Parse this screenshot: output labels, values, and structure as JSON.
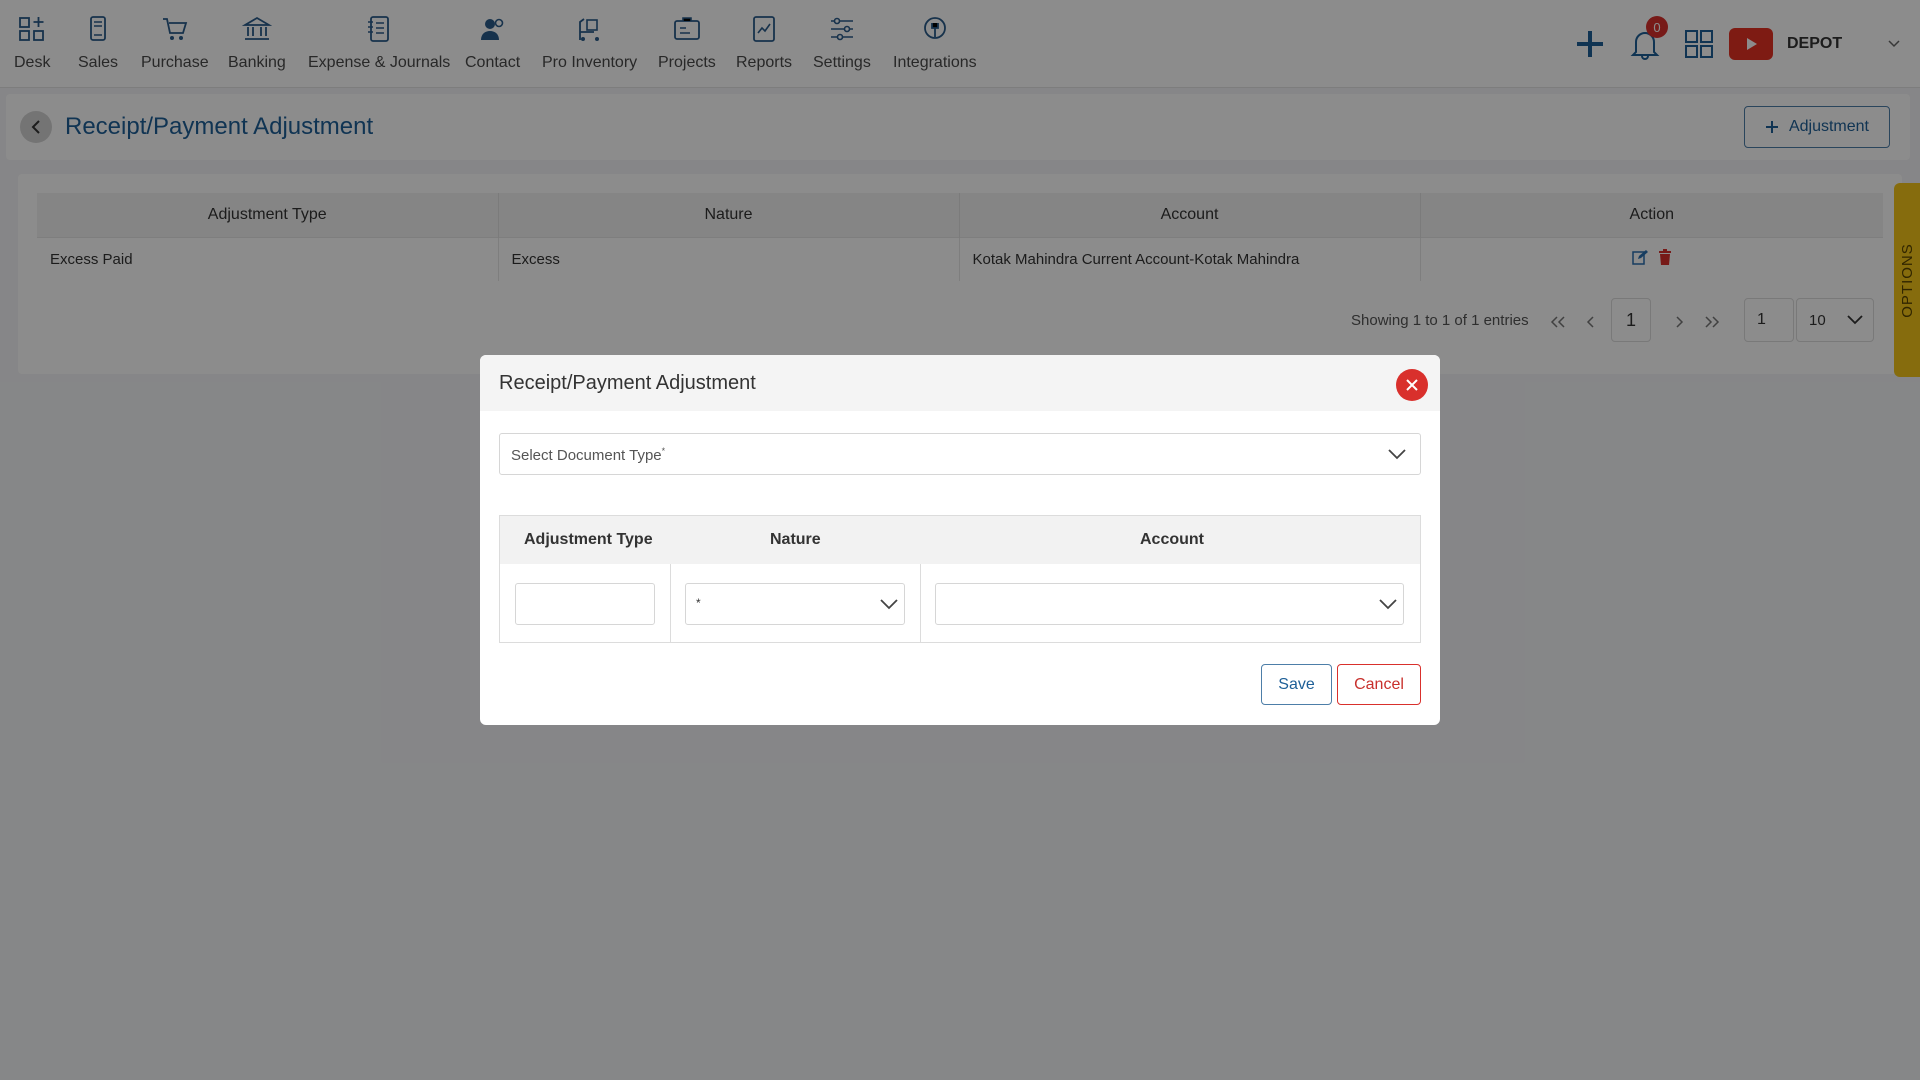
{
  "nav": {
    "items": [
      {
        "label": "Desk",
        "icon": "desk-icon"
      },
      {
        "label": "Sales",
        "icon": "sales-icon"
      },
      {
        "label": "Purchase",
        "icon": "purchase-icon"
      },
      {
        "label": "Banking",
        "icon": "banking-icon"
      },
      {
        "label": "Expense & Journals",
        "icon": "journal-icon"
      },
      {
        "label": "Contact",
        "icon": "contact-icon"
      },
      {
        "label": "Pro Inventory",
        "icon": "inventory-icon"
      },
      {
        "label": "Projects",
        "icon": "projects-icon"
      },
      {
        "label": "Reports",
        "icon": "reports-icon"
      },
      {
        "label": "Settings",
        "icon": "settings-icon"
      },
      {
        "label": "Integrations",
        "icon": "integrations-icon"
      }
    ],
    "notification_count": "0",
    "brand": "DEPOT"
  },
  "header": {
    "title": "Receipt/Payment Adjustment",
    "add_button": "Adjustment"
  },
  "table": {
    "columns": [
      "Adjustment Type",
      "Nature",
      "Account",
      "Action"
    ],
    "rows": [
      {
        "adjustment_type": "Excess Paid",
        "nature": "Excess",
        "account": "Kotak Mahindra Current Account-Kotak Mahindra"
      }
    ]
  },
  "pager": {
    "info": "Showing 1 to 1 of 1 entries",
    "current_page": "1",
    "goto_page": "1",
    "page_size": "10"
  },
  "options_tab": "OPTIONS",
  "modal": {
    "title": "Receipt/Payment Adjustment",
    "doc_type_placeholder": "Select Document Type",
    "required_mark": "*",
    "columns": {
      "adjustment_type": "Adjustment Type",
      "nature": "Nature",
      "account": "Account"
    },
    "nature_value": "*",
    "save": "Save",
    "cancel": "Cancel"
  },
  "colors": {
    "accent": "#1e5f97",
    "danger": "#d9302c",
    "options": "#f5c518"
  }
}
